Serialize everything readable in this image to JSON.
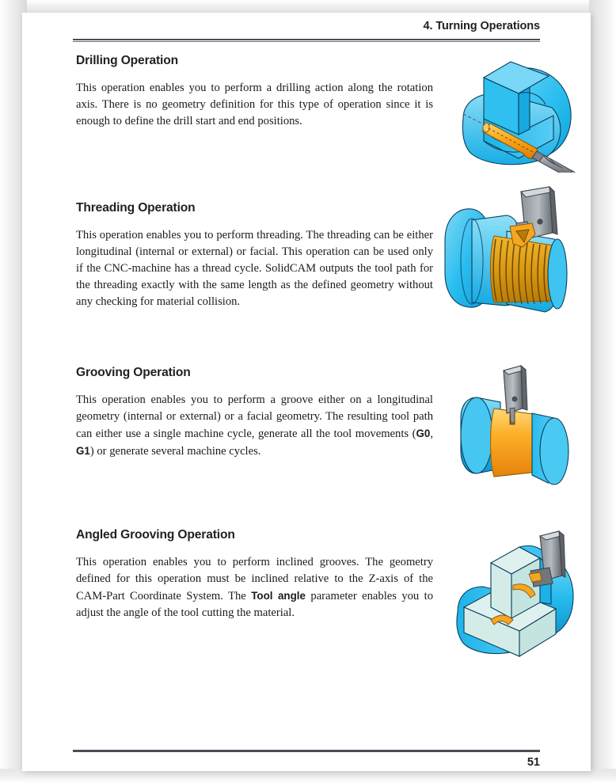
{
  "header": {
    "chapter_title": "4. Turning Operations"
  },
  "footer": {
    "page_number": "51"
  },
  "colors": {
    "body_cyan": "#29bdef",
    "cyan_dark": "#0e8fc4",
    "cyan_light": "#7fd9f7",
    "orange": "#faa61a",
    "orange_light": "#ffc34d",
    "orange_dark": "#e07c0a",
    "tool_gray": "#8c9196",
    "tool_gray_dark": "#5a6066",
    "section_face": "#dff1ee",
    "rule": "#4a4c55",
    "text": "#1b1b20"
  },
  "sections": [
    {
      "id": "drilling",
      "heading": "Drilling Operation",
      "body_html": "This operation enables you to perform a drilling action along the rotation axis. There is no geometry definition for this type of operation since it is enough to define the drill start and end positions.",
      "illustration": "drilling-operation-illustration"
    },
    {
      "id": "threading",
      "heading": "Threading Operation",
      "body_html": "This operation enables you to perform threading. The threading can be either longitudinal (internal or external) or facial. This operation can be used only if the CNC-machine has a thread cycle. SolidCAM outputs the tool path for the threading exactly with the same length as the defined geometry without any checking for material collision.",
      "illustration": "threading-operation-illustration"
    },
    {
      "id": "grooving",
      "heading": "Grooving Operation",
      "body_parts": [
        {
          "type": "text",
          "value": "This operation enables you to perform a groove either on a longitudinal geometry (internal or external) or a facial geometry. The resulting tool path can either use a single machine cycle, generate all the tool movements ("
        },
        {
          "type": "bold",
          "value": "G0"
        },
        {
          "type": "text",
          "value": ", "
        },
        {
          "type": "bold",
          "value": "G1"
        },
        {
          "type": "text",
          "value": ") or generate several machine cycles."
        }
      ],
      "illustration": "grooving-operation-illustration"
    },
    {
      "id": "angled-grooving",
      "heading": "Angled Grooving Operation",
      "body_parts": [
        {
          "type": "text",
          "value": "This operation enables you to perform inclined grooves. The geometry defined for this operation must be inclined relative to the Z-axis of the CAM-Part Coordinate System. The "
        },
        {
          "type": "bold",
          "value": "Tool angle"
        },
        {
          "type": "text",
          "value": " parameter enables you to adjust the angle of the tool cutting the material."
        }
      ],
      "illustration": "angled-grooving-operation-illustration"
    }
  ]
}
